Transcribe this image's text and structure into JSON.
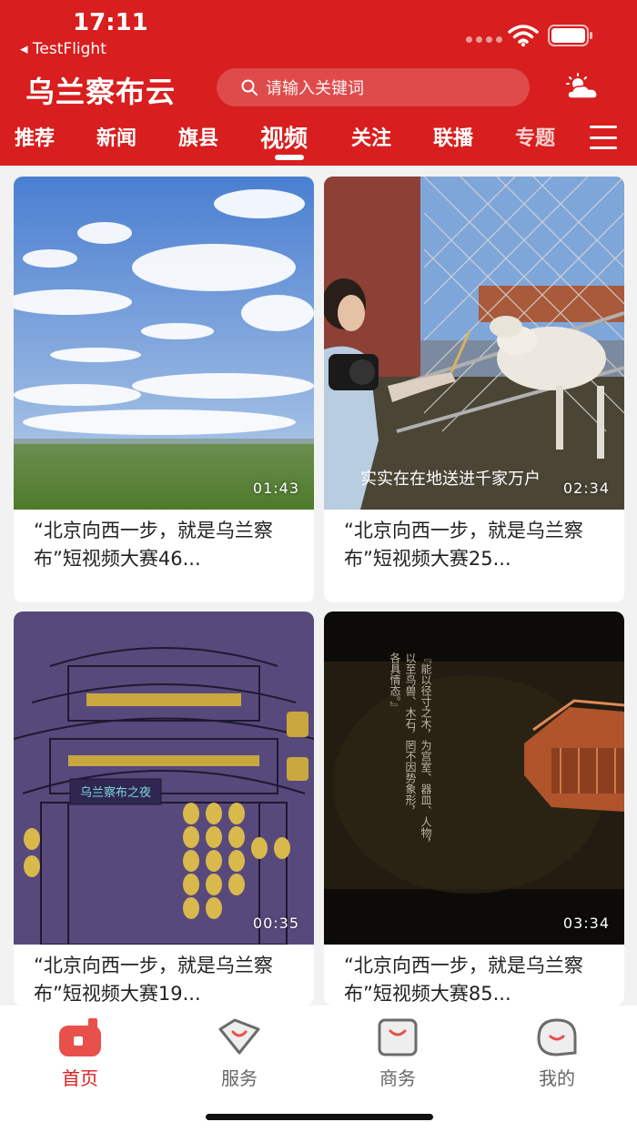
{
  "status_bar": {
    "time": "17:11",
    "back_label": "◂ TestFlight"
  },
  "header": {
    "app_title": "乌兰察布云",
    "search_placeholder": "请输入关键词"
  },
  "nav": {
    "tabs": [
      {
        "label": "推荐"
      },
      {
        "label": "新闻"
      },
      {
        "label": "旗县"
      },
      {
        "label": "视频",
        "active": true
      },
      {
        "label": "关注"
      },
      {
        "label": "联播"
      },
      {
        "label": "专题"
      }
    ]
  },
  "videos": [
    {
      "duration": "01:43",
      "title": "“北京向西一步，就是乌兰察布”短视频大赛46...",
      "thumbnail": "grassland-sky"
    },
    {
      "duration": "02:34",
      "subtitle": "实实在在地送进千家万户",
      "title": "“北京向西一步，就是乌兰察布”短视频大赛25...",
      "thumbnail": "woman-feeding-sheep"
    },
    {
      "duration": "00:35",
      "sign": "乌兰察布之夜",
      "title": "“北京向西一步，就是乌兰察布”短视频大赛19...",
      "thumbnail": "palace-illustration"
    },
    {
      "duration": "03:34",
      "poem_lines": [
        "『能以径寸之木，为宫室、器皿、人物，",
        "以至鸟兽、木石，罔不因势象形，",
        "各具情态。』"
      ],
      "title": "“北京向西一步，就是乌兰察布”短视频大赛85...",
      "thumbnail": "carved-wood-house"
    }
  ],
  "tabbar": {
    "items": [
      {
        "label": "首页",
        "icon": "home-icon",
        "active": true
      },
      {
        "label": "服务",
        "icon": "service-icon"
      },
      {
        "label": "商务",
        "icon": "business-icon"
      },
      {
        "label": "我的",
        "icon": "profile-icon"
      }
    ]
  },
  "colors": {
    "brand_red": "#d81e1e",
    "tab_inactive": "#666666"
  }
}
